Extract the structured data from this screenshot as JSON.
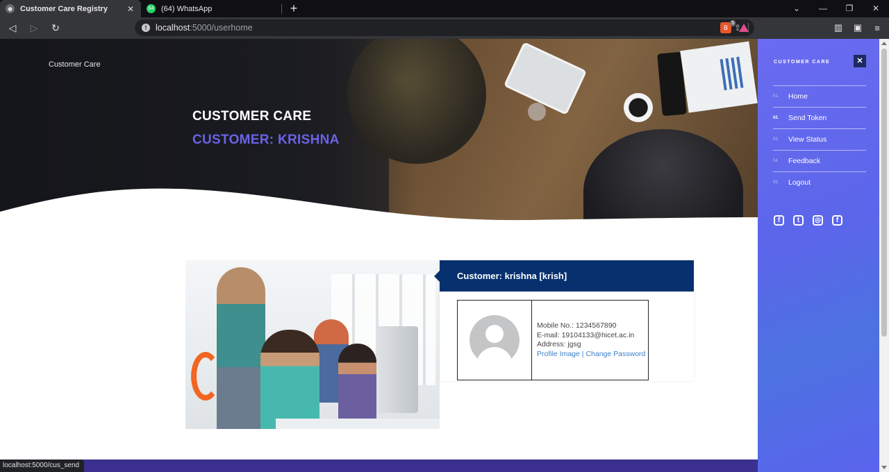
{
  "browser": {
    "tabs": [
      {
        "title": "Customer Care Registry",
        "icon": "globe-icon",
        "active": true
      },
      {
        "title": "(64) WhatsApp",
        "icon": "whatsapp-icon",
        "active": false
      }
    ],
    "new_tab": "+",
    "url": {
      "host": "localhost",
      "rest": ":5000/userhome"
    },
    "brave_badge": "5",
    "status_url": "localhost:5000/cus_send"
  },
  "hero": {
    "brand": "Customer Care",
    "title": "CUSTOMER CARE",
    "subtitle": "CUSTOMER: KRISHNA"
  },
  "card": {
    "heading": "Customer: krishna [krish]",
    "mobile": "Mobile No.: 1234567890",
    "email": "E-mail: 19104133@hicet.ac.in",
    "address": "Address: jgsg",
    "profile_image_link": "Profile Image",
    "separator": "|",
    "change_password_link": "Change Password"
  },
  "sidenav": {
    "title": "CUSTOMER CARE",
    "close": "✕",
    "items": [
      {
        "num": "01.",
        "label": "Home"
      },
      {
        "num": "02.",
        "label": "Send Token"
      },
      {
        "num": "03.",
        "label": "View Status"
      },
      {
        "num": "04.",
        "label": "Feedback"
      },
      {
        "num": "05.",
        "label": "Logout"
      }
    ],
    "social": [
      "facebook-icon",
      "twitter-icon",
      "instagram-icon",
      "facebook-icon"
    ]
  },
  "colors": {
    "accent_purple": "#6a63e8",
    "card_header": "#07306f",
    "sidenav_start": "#6a6bf0",
    "link": "#3d7fc6"
  }
}
